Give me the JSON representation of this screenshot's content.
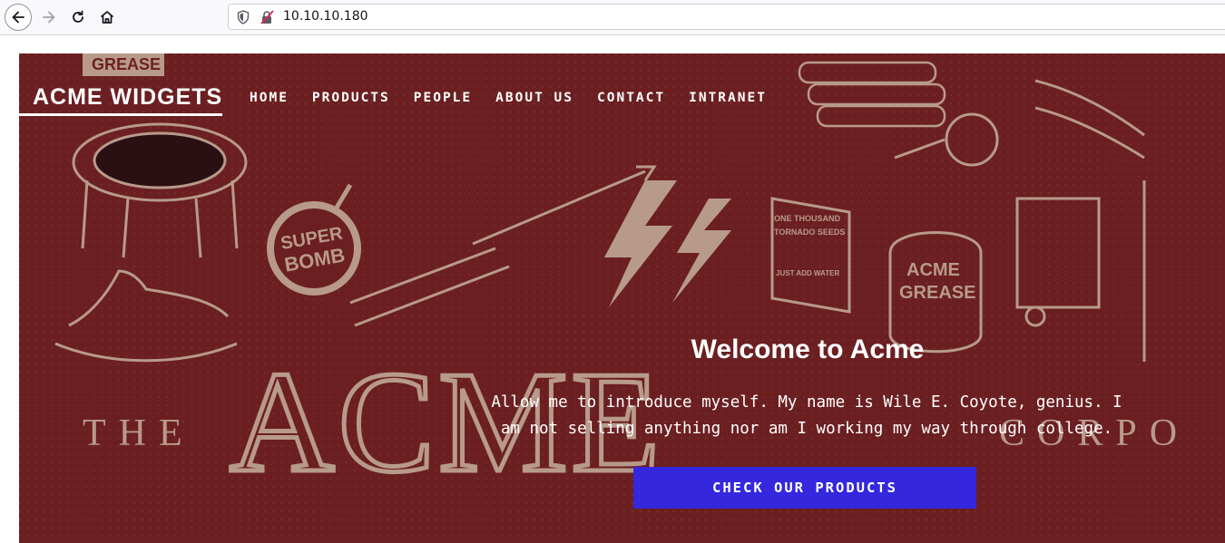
{
  "browser": {
    "url": "10.10.10.180",
    "icons": [
      "back-arrow-icon",
      "forward-arrow-icon",
      "reload-icon",
      "home-icon",
      "shield-icon",
      "insecure-lock-icon"
    ]
  },
  "site": {
    "brand": "ACME WIDGETS",
    "nav": [
      "HOME",
      "PRODUCTS",
      "PEOPLE",
      "ABOUT US",
      "CONTACT",
      "INTRANET"
    ],
    "hero": {
      "title": "Welcome to Acme",
      "text_line1": "Allow me to introduce myself. My name is Wile E. Coyote, genius. I",
      "text_line2": "am not selling anything nor am I working my way through college.",
      "cta": "CHECK OUR PRODUCTS"
    },
    "illustration": {
      "crate_label": "GREASE",
      "bomb_line1": "SUPER",
      "bomb_line2": "BOMB",
      "seed_box_line1": "ONE THOUSAND",
      "seed_box_line2": "TORNADO SEEDS",
      "seed_box_line3": "JUST ADD WATER",
      "grease_can_line1": "ACME",
      "grease_can_line2": "GREASE",
      "wordmark_left": "THE",
      "wordmark_main": "ACME",
      "wordmark_right": "CORPO"
    }
  },
  "colors": {
    "hero_bg": "#6b1f21",
    "illustration": "#b89a8a",
    "cta_bg": "#3427dd",
    "text": "#ffffff"
  }
}
